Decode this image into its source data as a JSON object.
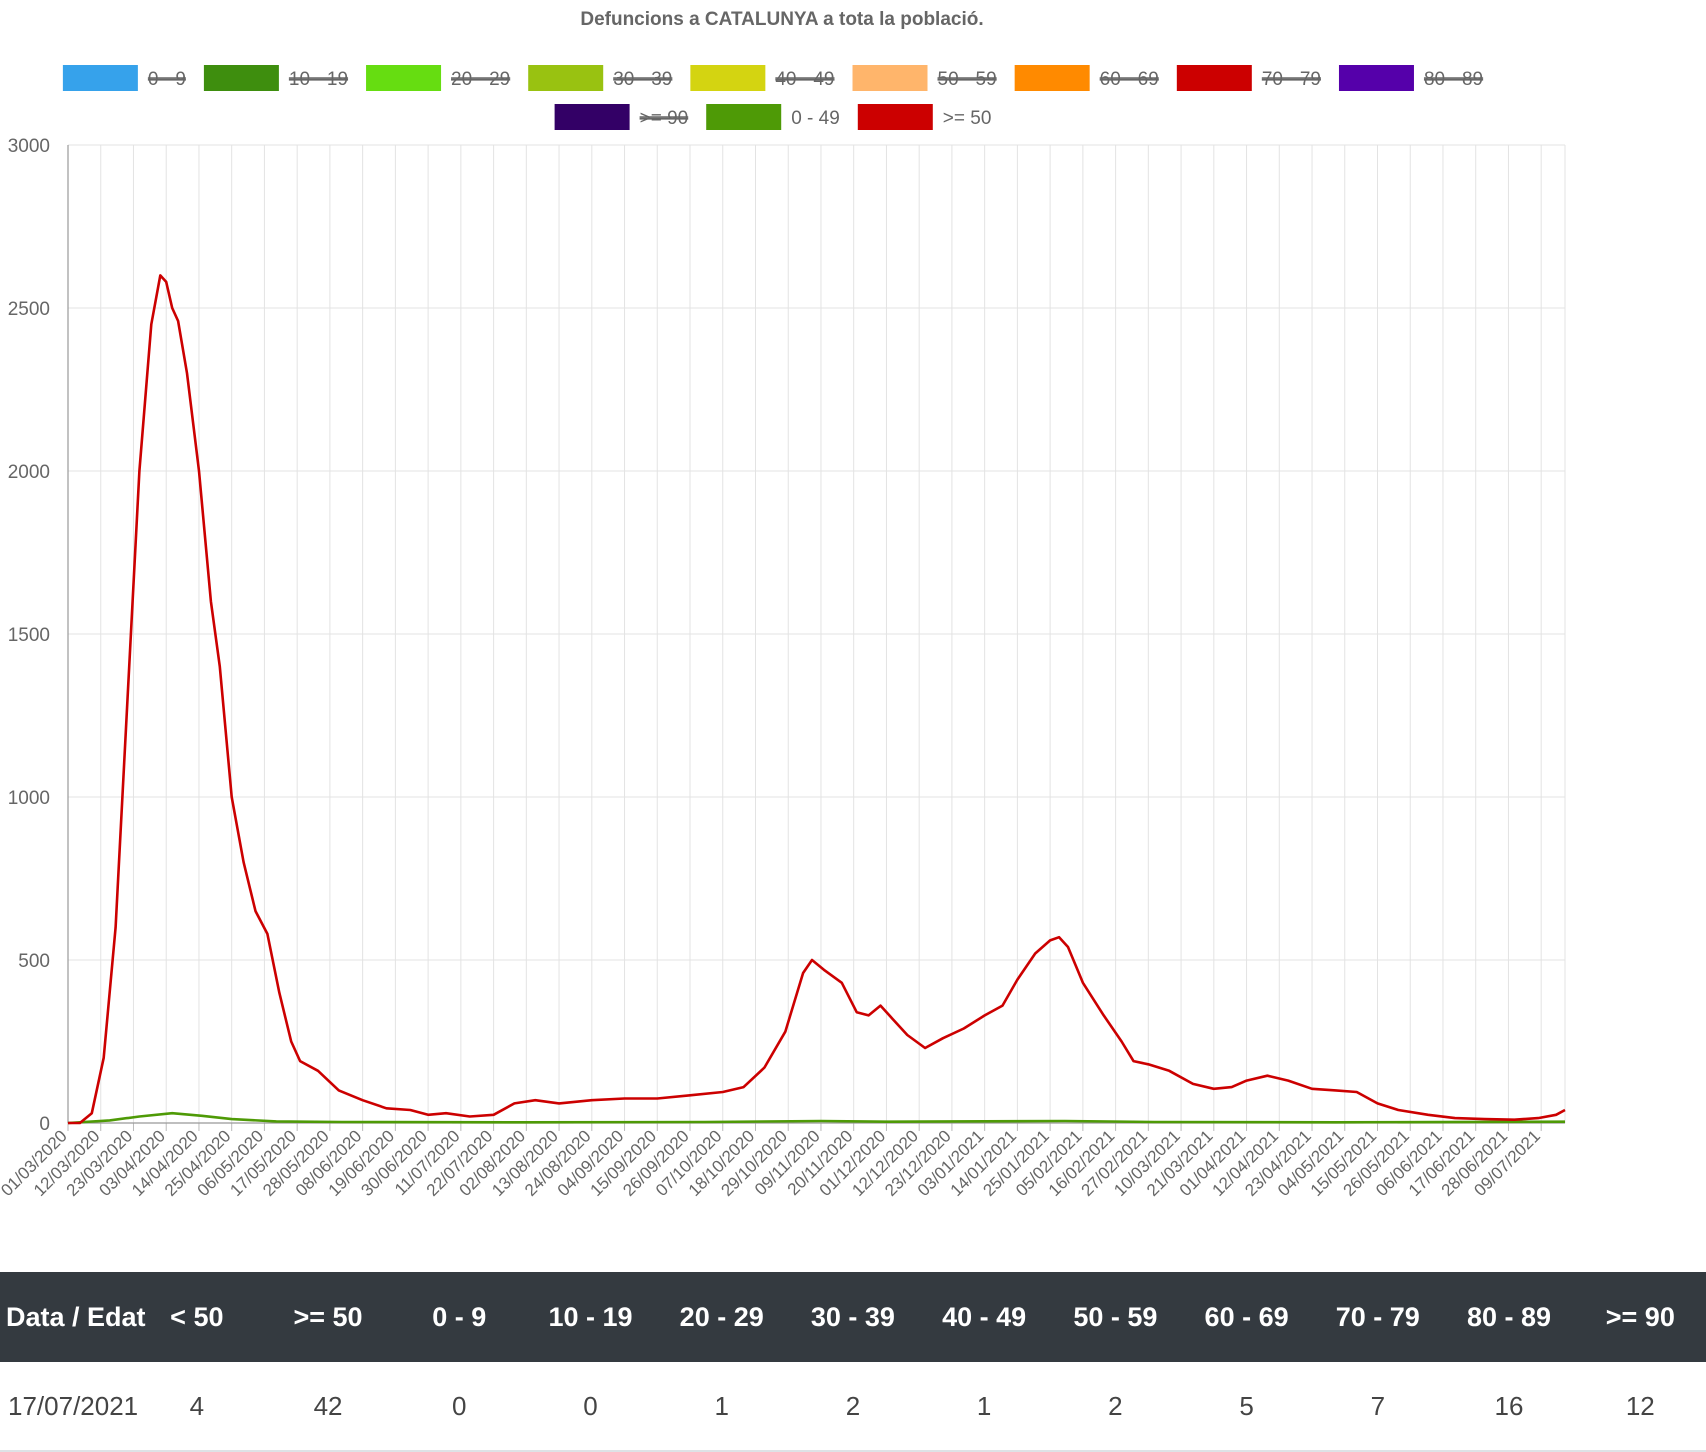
{
  "chart_data": {
    "type": "line",
    "title": "Defuncions a CATALUNYA a tota la població.",
    "ylim": [
      0,
      3000
    ],
    "yticks": [
      "0",
      "500",
      "1000",
      "1500",
      "2000",
      "2500",
      "3000"
    ],
    "grid": true,
    "legend_position": "top",
    "legend": [
      {
        "label": "0 - 9",
        "color": "#36a2eb",
        "hidden": true
      },
      {
        "label": "10 - 19",
        "color": "#3e8e0e",
        "hidden": true
      },
      {
        "label": "20 - 29",
        "color": "#66dd11",
        "hidden": true
      },
      {
        "label": "30 - 39",
        "color": "#99c211",
        "hidden": true
      },
      {
        "label": "40 - 49",
        "color": "#d4d411",
        "hidden": true
      },
      {
        "label": "50 - 59",
        "color": "#ffb56b",
        "hidden": true
      },
      {
        "label": "60 - 69",
        "color": "#ff8a00",
        "hidden": true
      },
      {
        "label": "70 - 79",
        "color": "#cc0000",
        "hidden": true
      },
      {
        "label": "80 - 89",
        "color": "#5500aa",
        "hidden": true
      },
      {
        "label": ">= 90",
        "color": "#330066",
        "hidden": true
      },
      {
        "label": "0 - 49",
        "color": "#4e9a06",
        "hidden": false
      },
      {
        "label": ">= 50",
        "color": "#cc0000",
        "hidden": false
      }
    ],
    "x_start": "01/03/2020",
    "x_end": "17/07/2021",
    "xticks": [
      "01/03/2020",
      "12/03/2020",
      "23/03/2020",
      "03/04/2020",
      "14/04/2020",
      "25/04/2020",
      "06/05/2020",
      "17/05/2020",
      "28/05/2020",
      "08/06/2020",
      "19/06/2020",
      "30/06/2020",
      "11/07/2020",
      "22/07/2020",
      "02/08/2020",
      "13/08/2020",
      "24/08/2020",
      "04/09/2020",
      "15/09/2020",
      "26/09/2020",
      "07/10/2020",
      "18/10/2020",
      "29/10/2020",
      "09/11/2020",
      "20/11/2020",
      "01/12/2020",
      "12/12/2020",
      "23/12/2020",
      "03/01/2021",
      "14/01/2021",
      "25/01/2021",
      "05/02/2021",
      "16/02/2021",
      "27/02/2021",
      "10/03/2021",
      "21/03/2021",
      "01/04/2021",
      "12/04/2021",
      "23/04/2021",
      "04/05/2021",
      "15/05/2021",
      "26/05/2021",
      "06/06/2021",
      "17/06/2021",
      "28/06/2021",
      "09/07/2021"
    ],
    "series": [
      {
        "name": ">= 50",
        "color": "#cc0000",
        "points": [
          [
            "01/03/2020",
            0
          ],
          [
            "05/03/2020",
            0
          ],
          [
            "09/03/2020",
            30
          ],
          [
            "13/03/2020",
            200
          ],
          [
            "17/03/2020",
            600
          ],
          [
            "21/03/2020",
            1300
          ],
          [
            "25/03/2020",
            2000
          ],
          [
            "29/03/2020",
            2450
          ],
          [
            "01/04/2020",
            2600
          ],
          [
            "03/04/2020",
            2580
          ],
          [
            "05/04/2020",
            2500
          ],
          [
            "07/04/2020",
            2460
          ],
          [
            "10/04/2020",
            2300
          ],
          [
            "14/04/2020",
            2000
          ],
          [
            "18/04/2020",
            1600
          ],
          [
            "21/04/2020",
            1400
          ],
          [
            "25/04/2020",
            1000
          ],
          [
            "29/04/2020",
            800
          ],
          [
            "03/05/2020",
            650
          ],
          [
            "07/05/2020",
            580
          ],
          [
            "11/05/2020",
            400
          ],
          [
            "15/05/2020",
            250
          ],
          [
            "18/05/2020",
            190
          ],
          [
            "24/05/2020",
            160
          ],
          [
            "31/05/2020",
            100
          ],
          [
            "08/06/2020",
            70
          ],
          [
            "16/06/2020",
            45
          ],
          [
            "24/06/2020",
            40
          ],
          [
            "30/06/2020",
            25
          ],
          [
            "06/07/2020",
            30
          ],
          [
            "14/07/2020",
            20
          ],
          [
            "22/07/2020",
            25
          ],
          [
            "29/07/2020",
            60
          ],
          [
            "05/08/2020",
            70
          ],
          [
            "13/08/2020",
            60
          ],
          [
            "24/08/2020",
            70
          ],
          [
            "04/09/2020",
            75
          ],
          [
            "15/09/2020",
            75
          ],
          [
            "26/09/2020",
            85
          ],
          [
            "07/10/2020",
            95
          ],
          [
            "14/10/2020",
            110
          ],
          [
            "21/10/2020",
            170
          ],
          [
            "28/10/2020",
            280
          ],
          [
            "03/11/2020",
            460
          ],
          [
            "06/11/2020",
            500
          ],
          [
            "10/11/2020",
            470
          ],
          [
            "16/11/2020",
            430
          ],
          [
            "21/11/2020",
            340
          ],
          [
            "25/11/2020",
            330
          ],
          [
            "29/11/2020",
            360
          ],
          [
            "03/12/2020",
            320
          ],
          [
            "08/12/2020",
            270
          ],
          [
            "14/12/2020",
            230
          ],
          [
            "20/12/2020",
            260
          ],
          [
            "27/12/2020",
            290
          ],
          [
            "03/01/2021",
            330
          ],
          [
            "09/01/2021",
            360
          ],
          [
            "14/01/2021",
            440
          ],
          [
            "20/01/2021",
            520
          ],
          [
            "25/01/2021",
            560
          ],
          [
            "28/01/2021",
            570
          ],
          [
            "31/01/2021",
            540
          ],
          [
            "05/02/2021",
            430
          ],
          [
            "12/02/2021",
            330
          ],
          [
            "18/02/2021",
            250
          ],
          [
            "22/02/2021",
            190
          ],
          [
            "27/02/2021",
            180
          ],
          [
            "06/03/2021",
            160
          ],
          [
            "14/03/2021",
            120
          ],
          [
            "21/03/2021",
            105
          ],
          [
            "27/03/2021",
            110
          ],
          [
            "01/04/2021",
            130
          ],
          [
            "08/04/2021",
            145
          ],
          [
            "15/04/2021",
            130
          ],
          [
            "23/04/2021",
            105
          ],
          [
            "01/05/2021",
            100
          ],
          [
            "08/05/2021",
            95
          ],
          [
            "15/05/2021",
            60
          ],
          [
            "22/05/2021",
            40
          ],
          [
            "01/06/2021",
            25
          ],
          [
            "10/06/2021",
            15
          ],
          [
            "20/06/2021",
            12
          ],
          [
            "30/06/2021",
            10
          ],
          [
            "08/07/2021",
            15
          ],
          [
            "14/07/2021",
            25
          ],
          [
            "17/07/2021",
            40
          ]
        ]
      },
      {
        "name": "0 - 49",
        "color": "#4e9a06",
        "points": [
          [
            "01/03/2020",
            0
          ],
          [
            "15/03/2020",
            8
          ],
          [
            "25/03/2020",
            20
          ],
          [
            "05/04/2020",
            30
          ],
          [
            "15/04/2020",
            22
          ],
          [
            "25/04/2020",
            12
          ],
          [
            "10/05/2020",
            5
          ],
          [
            "01/06/2020",
            3
          ],
          [
            "01/08/2020",
            2
          ],
          [
            "01/10/2020",
            3
          ],
          [
            "09/11/2020",
            6
          ],
          [
            "01/12/2020",
            4
          ],
          [
            "30/01/2021",
            6
          ],
          [
            "01/03/2021",
            3
          ],
          [
            "01/05/2021",
            2
          ],
          [
            "17/07/2021",
            4
          ]
        ]
      }
    ]
  },
  "table": {
    "headers": [
      "Data / Edat",
      "< 50",
      ">= 50",
      "0 - 9",
      "10 - 19",
      "20 - 29",
      "30 - 39",
      "40 - 49",
      "50 - 59",
      "60 - 69",
      "70 - 79",
      "80 - 89",
      ">= 90"
    ],
    "rows": [
      [
        "17/07/2021",
        "4",
        "42",
        "0",
        "0",
        "1",
        "2",
        "1",
        "2",
        "5",
        "7",
        "16",
        "12"
      ]
    ]
  }
}
